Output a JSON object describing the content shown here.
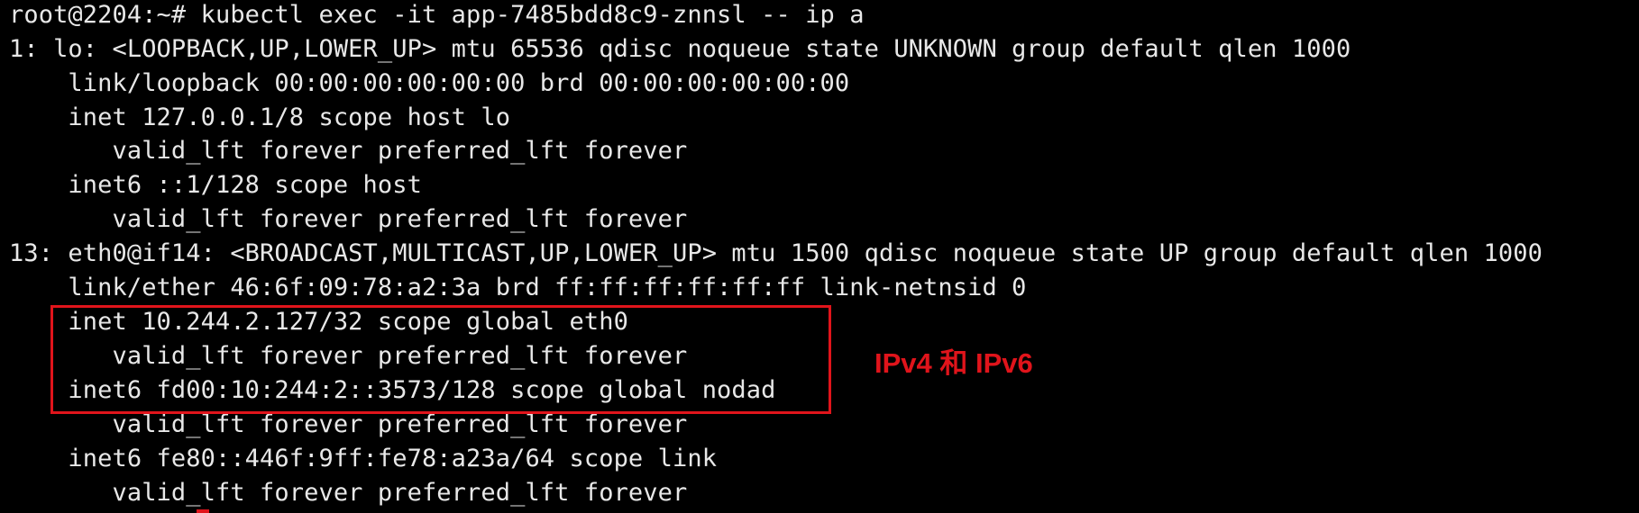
{
  "terminal": {
    "lines": [
      "root@2204:~# kubectl exec -it app-7485bdd8c9-znnsl -- ip a",
      "1: lo: <LOOPBACK,UP,LOWER_UP> mtu 65536 qdisc noqueue state UNKNOWN group default qlen 1000",
      "    link/loopback 00:00:00:00:00:00 brd 00:00:00:00:00:00",
      "    inet 127.0.0.1/8 scope host lo",
      "       valid_lft forever preferred_lft forever",
      "    inet6 ::1/128 scope host",
      "       valid_lft forever preferred_lft forever",
      "13: eth0@if14: <BROADCAST,MULTICAST,UP,LOWER_UP> mtu 1500 qdisc noqueue state UP group default qlen 1000",
      "    link/ether 46:6f:09:78:a2:3a brd ff:ff:ff:ff:ff:ff link-netnsid 0",
      "    inet 10.244.2.127/32 scope global eth0",
      "       valid_lft forever preferred_lft forever",
      "    inet6 fd00:10:244:2::3573/128 scope global nodad",
      "       valid_lft forever preferred_lft forever",
      "    inet6 fe80::446f:9ff:fe78:a23a/64 scope link",
      "       valid_lft forever preferred_lft forever"
    ]
  },
  "annotation": {
    "label": "IPv4 和 IPv6",
    "color": "#e0141b"
  },
  "colors": {
    "background": "#000000",
    "text": "#e8e8e8",
    "highlight": "#e0141b"
  }
}
